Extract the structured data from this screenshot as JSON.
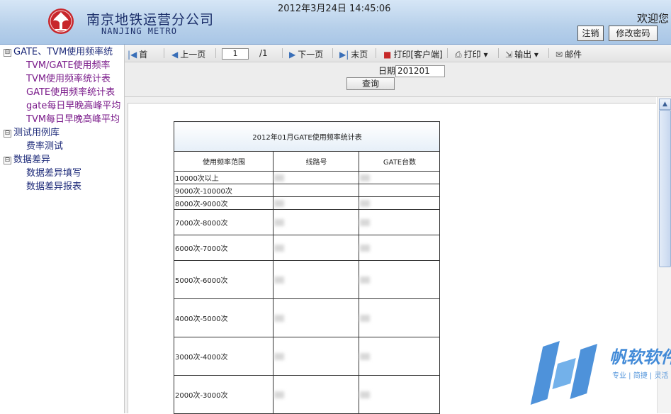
{
  "header": {
    "title_cn": "南京地铁运营分公司",
    "title_en": "NANJING METRO",
    "datetime": "2012年3月24日  14:45:06",
    "welcome": "欢迎您",
    "logout_label": "注销",
    "change_password_label": "修改密码"
  },
  "sidebar": {
    "items": [
      {
        "toggle": "⊟",
        "label": "GATE、TVM使用频率统"
      },
      {
        "label": "TVM/GATE使用频率"
      },
      {
        "label": "TVM使用频率统计表"
      },
      {
        "label": "GATE使用频率统计表"
      },
      {
        "label": "gate每日早晚高峰平均"
      },
      {
        "label": "TVM每日早晚高峰平均"
      },
      {
        "toggle": "⊟",
        "label": "测试用例库"
      },
      {
        "label": "费率测试"
      },
      {
        "toggle": "⊟",
        "label": "数据差异"
      },
      {
        "label": "数据差异填写"
      },
      {
        "label": "数据差异报表"
      }
    ]
  },
  "toolbar": {
    "first_label": "首",
    "prev_label": "上一页",
    "page_value": "1",
    "page_total": "/1",
    "next_label": "下一页",
    "last_label": "末页",
    "print_client_label": "打印[客户端]",
    "print_label": "打印",
    "export_label": "输出",
    "mail_label": "邮件"
  },
  "query": {
    "date_label": "日期",
    "date_value": "201201",
    "query_button": "查询"
  },
  "report": {
    "title": "2012年01月GATE使用频率统计表",
    "columns": [
      "使用频率范围",
      "线路号",
      "GATE台数"
    ],
    "ranges": [
      "10000次以上",
      "9000次-10000次",
      "8000次-9000次",
      "7000次-8000次",
      "6000次-7000次",
      "5000次-6000次",
      "4000次-5000次",
      "3000次-4000次",
      "2000次-3000次"
    ]
  },
  "watermark": {
    "brand": "帆软软件",
    "slogan": "专业 | 简捷 | 灵活"
  },
  "colors": {
    "header_bg": "#b7d0ea",
    "logo_red": "#c8262b",
    "title_text": "#1c2f6a",
    "watermark_blue": "#2f7fd4"
  }
}
